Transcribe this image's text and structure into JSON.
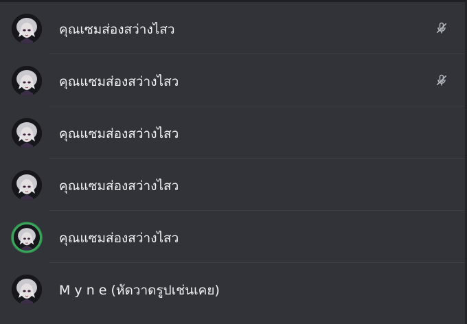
{
  "participants": [
    {
      "name": "คุณเซมส่องสว่างไสว",
      "muted": true,
      "speaking": false
    },
    {
      "name": "คุณแซมส่องสว่างไสว",
      "muted": true,
      "speaking": false
    },
    {
      "name": "คุณแซมส่องสว่างไสว",
      "muted": false,
      "speaking": false
    },
    {
      "name": "คุณแซมส่องสว่างไสว",
      "muted": false,
      "speaking": false
    },
    {
      "name": "คุณแซมส่องสว่างไสว",
      "muted": false,
      "speaking": true
    },
    {
      "name": "M y n e (หัดวาดรูปเช่นเคย)",
      "muted": false,
      "speaking": false
    }
  ],
  "icons": {
    "muted": "microphone-muted-icon"
  },
  "colors": {
    "background": "#313338",
    "divider": "#3d3f45",
    "text": "#f2f3f5",
    "icon": "#b5bac1",
    "speaking_ring": "#3ba55d"
  }
}
